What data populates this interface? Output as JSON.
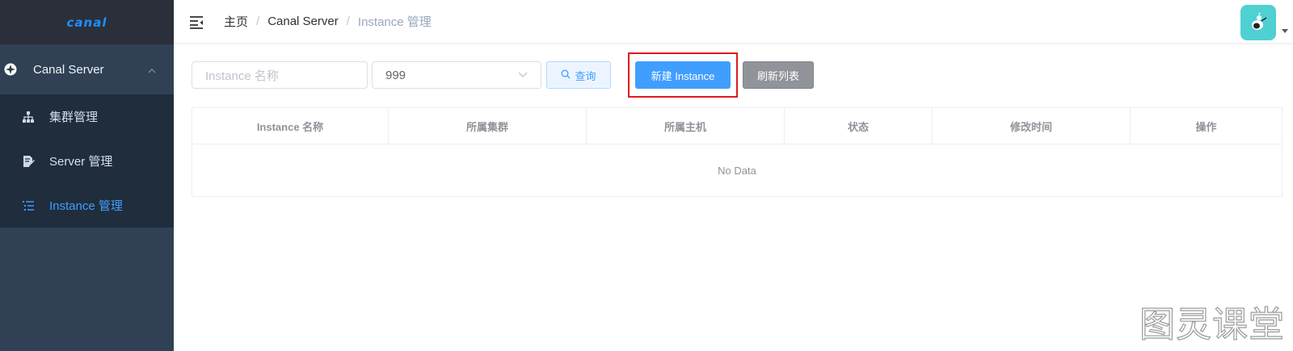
{
  "sidebar": {
    "logo": "canal",
    "group": {
      "label": "Canal Server",
      "icon": "compass-icon"
    },
    "items": [
      {
        "label": "集群管理",
        "icon": "sitemap-icon",
        "active": false
      },
      {
        "label": "Server 管理",
        "icon": "edit-doc-icon",
        "active": false
      },
      {
        "label": "Instance 管理",
        "icon": "list-icon",
        "active": true
      }
    ]
  },
  "navbar": {
    "breadcrumb": [
      "主页",
      "Canal Server",
      "Instance 管理"
    ],
    "separator": "/"
  },
  "filters": {
    "name_placeholder": "Instance 名称",
    "select_value": "999",
    "query_label": "查询",
    "new_label": "新建 Instance",
    "refresh_label": "刷新列表"
  },
  "table": {
    "columns": [
      "Instance 名称",
      "所属集群",
      "所属主机",
      "状态",
      "修改时间",
      "操作"
    ],
    "empty_text": "No Data"
  },
  "watermark": "图灵课堂",
  "colors": {
    "sidebar": "#304156",
    "primary": "#409eff",
    "highlight": "#e0191f"
  }
}
